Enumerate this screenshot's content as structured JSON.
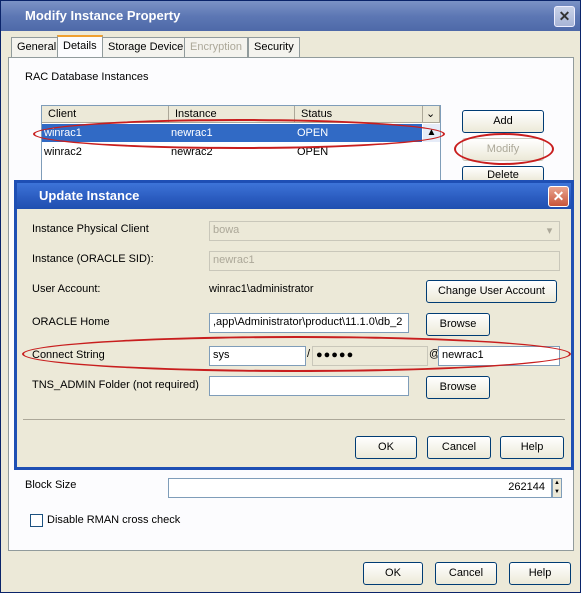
{
  "outer": {
    "title": "Modify Instance Property",
    "tabs": [
      "General",
      "Details",
      "Storage Device",
      "Encryption",
      "Security"
    ],
    "section_label": "RAC Database Instances",
    "columns": [
      "Client",
      "Instance",
      "Status"
    ],
    "rows": [
      {
        "client": "winrac1",
        "instance": "newrac1",
        "status": "OPEN"
      },
      {
        "client": "winrac2",
        "instance": "newrac2",
        "status": "OPEN"
      }
    ],
    "buttons": {
      "add": "Add",
      "modify": "Modify",
      "delete": "Delete",
      "ok": "OK",
      "cancel": "Cancel",
      "help": "Help"
    },
    "block_size_label": "Block Size",
    "block_size_value": "262144",
    "rman_label": "Disable RMAN cross check"
  },
  "inner": {
    "title": "Update Instance",
    "physical_client_label": "Instance Physical Client",
    "physical_client_value": "bowa",
    "instance_sid_label": "Instance (ORACLE SID):",
    "instance_sid_value": "newrac1",
    "user_account_label": "User Account:",
    "user_account_value": "winrac1\\administrator",
    "change_user_button": "Change User Account",
    "oracle_home_label": "ORACLE Home",
    "oracle_home_value": ",app\\Administrator\\product\\11.1.0\\db_2",
    "browse_label": "Browse",
    "connect_label": "Connect String",
    "connect_user": "sys",
    "slash": "/",
    "connect_password": "●●●●●",
    "at": "@",
    "connect_service": "newrac1",
    "tns_label": "TNS_ADMIN Folder (not required)",
    "tns_value": "",
    "ok": "OK",
    "cancel": "Cancel",
    "help": "Help"
  },
  "icons": {
    "close": "close-icon",
    "dropdown": "chevron-down-icon",
    "scroll_up": "chevron-up-icon"
  },
  "colors": {
    "title_active": "#2a5bbf",
    "title_inactive": "#5d77b4",
    "highlight": "#c81e1e",
    "selection": "#316ac5"
  }
}
